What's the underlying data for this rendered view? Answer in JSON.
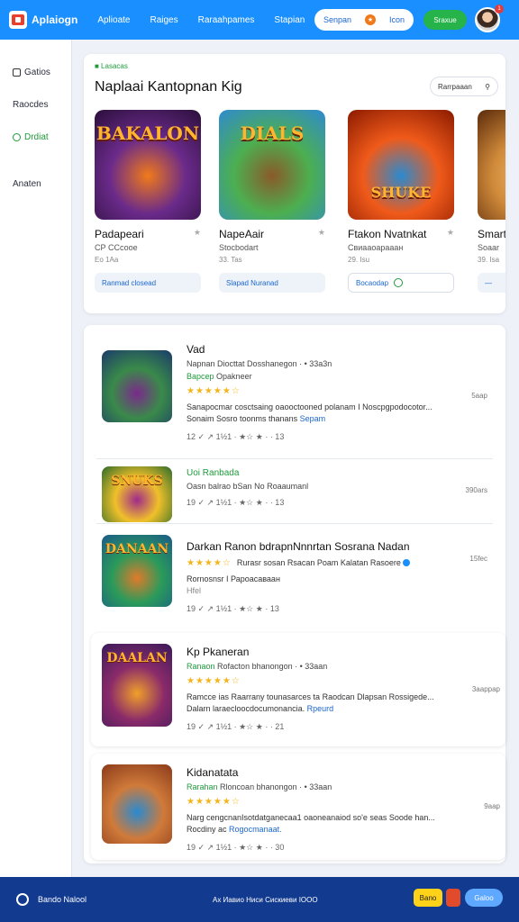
{
  "header": {
    "app_title": "Aplaiogn",
    "nav": [
      "Aplioate",
      "Raiges",
      "Raraahpames",
      "Stapian"
    ],
    "search_label": "Senpan",
    "search_badge": "★",
    "search_right": "Icon",
    "action_label": "Sraxue",
    "notification_count": "1"
  },
  "sidebar": {
    "items": [
      {
        "label": "Gatios",
        "icon": "grid-icon"
      },
      {
        "label": "Raocdes",
        "icon": "none"
      },
      {
        "label": "Drdiat",
        "icon": "refresh-icon"
      },
      {
        "label": "Anaten",
        "icon": "none"
      }
    ]
  },
  "featured": {
    "tag": "■ Lasacas",
    "title": "Naplaai Kantopnan Kig",
    "search_label": "Rarrpaaan",
    "items": [
      {
        "name": "Padapeari",
        "sub": "СР ССсоое",
        "meta": "Ео 1Аа",
        "action": "Ranmad closead",
        "art_text": "BAKALON",
        "colors": [
          "#2a0f3a",
          "#6a2a8a",
          "#f07a1a"
        ]
      },
      {
        "name": "NapeAair",
        "sub": "Stocbodart",
        "meta": "33. Tas",
        "action": "Slapad Nuranad",
        "art_text": "DIALS",
        "colors": [
          "#2f8ad0",
          "#4caf50",
          "#8a5a2a"
        ]
      },
      {
        "name": "Ftakon Nvatnkat",
        "sub": "Свиааоарааан",
        "meta": "29. Isu",
        "action": "Bocaodaр",
        "art_text": "SHUKE",
        "colors": [
          "#8a1a00",
          "#f05a1a",
          "#2a8ad0"
        ]
      },
      {
        "name": "Smart",
        "sub": "Soaar",
        "meta": "39. Isa",
        "action": "—",
        "art_text": "",
        "colors": [
          "#5a2a0a",
          "#d08a3a",
          "#f0c06a"
        ]
      }
    ]
  },
  "list": {
    "rows": [
      {
        "title": "Vad",
        "sub_a": "Napnan",
        "sub_b": "Diocttat Dosshanegon · • 33a3n",
        "green": "Bapcep",
        "green_sub": "Opakneer",
        "stars": "★★★★★☆",
        "desc": "Sanapocmar cosctsaing oaooctooned polanam I Noscpgpodocotor...",
        "desc_link_pre": "Sonaim Sosro toonms thanans",
        "desc_link": "Sepam",
        "meta": "12 ✓ ↗ 1½1 · ★☆ ★ · · 13",
        "right": "5аар",
        "art_text": "",
        "colors": [
          "#1a3a6a",
          "#3a8a4a",
          "#7a2a8a"
        ]
      },
      {
        "title": "Uoi Ranbada",
        "sub_a": "Oasn balrao",
        "sub_b": "bSan No Roaaumanl",
        "meta": "19 ✓ ↗ 1½1 · ★☆ ★ · · 13",
        "right": "390ars",
        "art_text": "SNUKS",
        "colors": [
          "#2a6a2a",
          "#f0c02a",
          "#a02a8a"
        ]
      },
      {
        "title": "Darkan Ranon bdrapnNnnrtan Sosrana Nadan",
        "stars": "★★★★☆",
        "stars_text": "Rurasr sosan Rsacan Poam Kalatan Rasoere",
        "desc": "Rornosnsr I Рароасаваан",
        "desc2": "Hfel",
        "meta": "19 ✓ ↗ 1½1 · ★☆ ★ · 13",
        "right": "15fec",
        "art_text": "DANAAN",
        "colors": [
          "#1a5a8a",
          "#2a9a5a",
          "#e07a2a"
        ]
      },
      {
        "title": "Kp Pkaneran",
        "sub_a": "Ranaon",
        "sub_b": "Rofacton bhanongon · • 33aan",
        "stars": "★★★★★☆",
        "desc": "Ramcce ias Raarrany tounasarces ta Raodcan Dlapsan Rossigede...",
        "desc_link_pre": "Dalarn laraecloocdocumonancia.",
        "desc_link": "Rpeurd",
        "meta": "19 ✓ ↗ 1½1 · ★☆ ★ · · 21",
        "right": "3ааррар",
        "art_text": "DAALAN",
        "colors": [
          "#3a1a5a",
          "#8a2a6a",
          "#f0a02a"
        ]
      },
      {
        "title": "Kidanatata",
        "sub_a": "Rarahan",
        "sub_b": "Rloncoan bhanongon · • 33aan",
        "stars": "★★★★★☆",
        "desc": "Narg cengcnanIsotdatganecaa1 oaoneanaiod so'e seas Soode han...",
        "desc_link_pre": "Rocdiny ac",
        "desc_link": "Rogocmanaat.",
        "meta": "19 ✓ ↗ 1½1 · ★☆ ★ · · 30",
        "right": "9аар",
        "art_text": "",
        "colors": [
          "#8a3a1a",
          "#d07a3a",
          "#2a8ad0"
        ]
      }
    ]
  },
  "footer": {
    "brand": "Bando Nalool",
    "links": "Ах Иавио Ниси Сискиеви ІООО",
    "btn_yellow": "Bano",
    "btn_blue": "Galoo"
  }
}
